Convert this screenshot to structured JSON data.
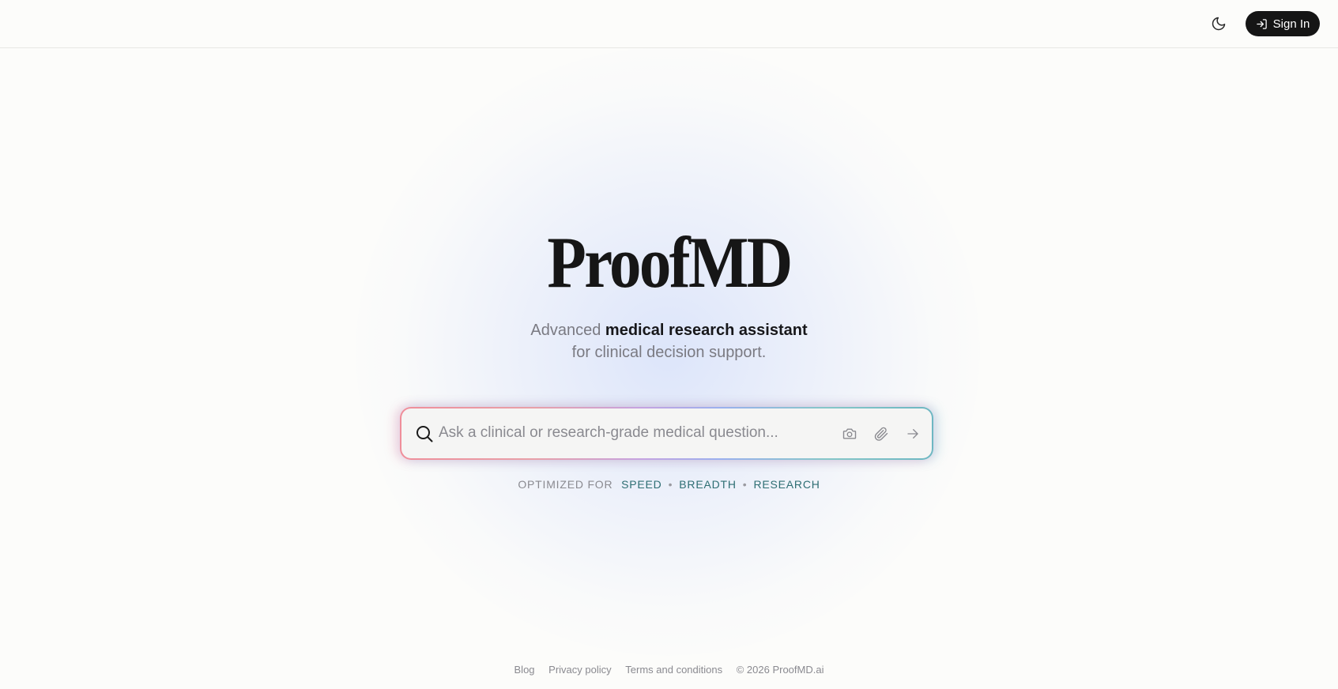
{
  "header": {
    "theme_toggle_icon": "moon-icon",
    "signin_label": "Sign In",
    "signin_icon": "sign-in-icon"
  },
  "hero": {
    "logo": "ProofMD",
    "tagline_prefix": "Advanced ",
    "tagline_bold": "medical research assistant",
    "tagline_line2": "for clinical decision support."
  },
  "search": {
    "placeholder": "Ask a clinical or research-grade medical question...",
    "value": "",
    "search_icon": "search-icon",
    "camera_icon": "camera-icon",
    "attach_icon": "paperclip-icon",
    "send_icon": "arrow-right-icon"
  },
  "optimized": {
    "label": "OPTIMIZED FOR",
    "modes": [
      "SPEED",
      "BREADTH",
      "RESEARCH"
    ]
  },
  "footer": {
    "links": [
      "Blog",
      "Privacy policy",
      "Terms and conditions"
    ],
    "copyright": "© 2026 ProofMD.ai"
  },
  "colors": {
    "background": "#fcfcfa",
    "button_dark": "#151515",
    "accent_teal": "#2e6e73"
  }
}
